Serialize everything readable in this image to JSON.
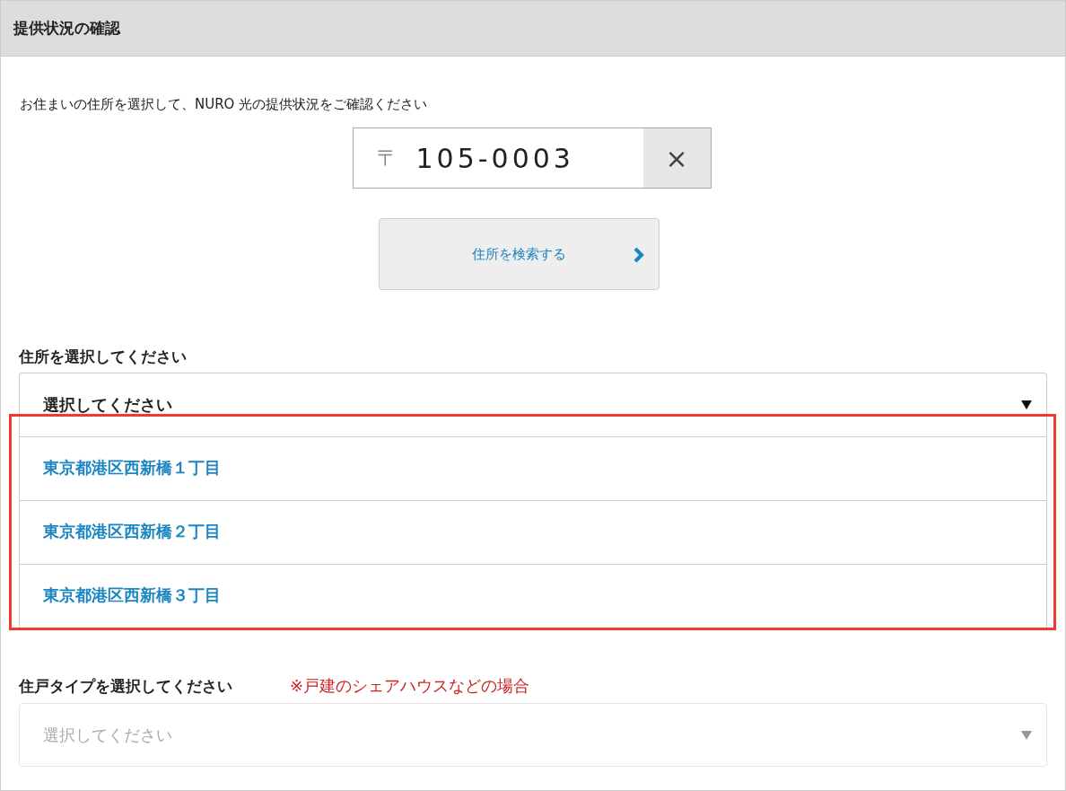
{
  "panel": {
    "title": "提供状況の確認"
  },
  "intro": "お住まいの住所を選択して、NURO 光の提供状況をご確認ください",
  "postal_field": {
    "prefix": "〒",
    "value": "105-0003",
    "clear": "×"
  },
  "search_button": {
    "label": "住所を検索する"
  },
  "address_select": {
    "label": "住所を選択してください",
    "value": "選択してください",
    "expanded": true,
    "disabled": false,
    "highlighted": true,
    "options": [
      {
        "label": "東京都港区西新橋１丁目",
        "selected": false
      },
      {
        "label": "東京都港区西新橋２丁目",
        "selected": false
      },
      {
        "label": "東京都港区西新橋３丁目",
        "selected": false
      }
    ]
  },
  "dwelling_select": {
    "label": "住戸タイプを選択してください",
    "note": "※戸建のシェアハウスなどの場合",
    "placeholder": "選択してください",
    "disabled": true
  }
}
